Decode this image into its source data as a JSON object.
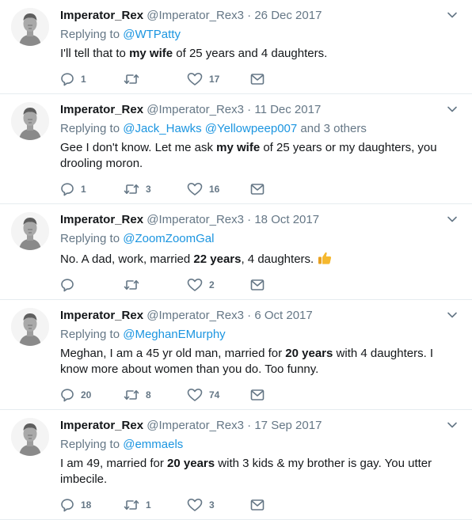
{
  "colors": {
    "link": "#1b95e0",
    "muted": "#657786",
    "text": "#14171a",
    "divider": "#e6ecf0"
  },
  "icons": {
    "reply": "reply-icon",
    "retweet": "retweet-icon",
    "like": "heart-icon",
    "dm": "envelope-icon",
    "menu": "chevron-down-icon"
  },
  "tweets": [
    {
      "name": "Imperator_Rex",
      "handle": "@Imperator_Rex3",
      "sep": "·",
      "date": "26 Dec 2017",
      "replying_prefix": "Replying to",
      "replying_to": "@WTPatty",
      "others": "",
      "text_before": "I'll tell that to ",
      "text_bold": "my wife",
      "text_after": " of 25 years and 4 daughters.",
      "replies": "1",
      "retweets": "",
      "likes": "17"
    },
    {
      "name": "Imperator_Rex",
      "handle": "@Imperator_Rex3",
      "sep": "·",
      "date": "11 Dec 2017",
      "replying_prefix": "Replying to",
      "replying_to": "@Jack_Hawks @Yellowpeep007",
      "others": "and 3 others",
      "text_before": "Gee I don't know. Let me ask ",
      "text_bold": "my wife",
      "text_after": " of 25 years or my daughters, you drooling moron.",
      "replies": "1",
      "retweets": "3",
      "likes": "16"
    },
    {
      "name": "Imperator_Rex",
      "handle": "@Imperator_Rex3",
      "sep": "·",
      "date": "18 Oct 2017",
      "replying_prefix": "Replying to",
      "replying_to": "@ZoomZoomGal",
      "others": "",
      "text_before": "No. A dad, work, married ",
      "text_bold": "22 years",
      "text_after": ", 4 daughters.",
      "emoji": "thumbs-up-emoji",
      "replies": "",
      "retweets": "",
      "likes": "2"
    },
    {
      "name": "Imperator_Rex",
      "handle": "@Imperator_Rex3",
      "sep": "·",
      "date": "6 Oct 2017",
      "replying_prefix": "Replying to",
      "replying_to": "@MeghanEMurphy",
      "others": "",
      "text_before": "Meghan, I am a 45 yr old man, married for ",
      "text_bold": "20 years",
      "text_after": " with 4 daughters. I know more about women than you do. Too funny.",
      "replies": "20",
      "retweets": "8",
      "likes": "74"
    },
    {
      "name": "Imperator_Rex",
      "handle": "@Imperator_Rex3",
      "sep": "·",
      "date": "17 Sep 2017",
      "replying_prefix": "Replying to",
      "replying_to": "@emmaels",
      "others": "",
      "text_before": "I am 49, married for ",
      "text_bold": "20 years",
      "text_after": " with 3 kids & my brother is gay. You utter imbecile.",
      "replies": "18",
      "retweets": "1",
      "likes": "3"
    }
  ]
}
